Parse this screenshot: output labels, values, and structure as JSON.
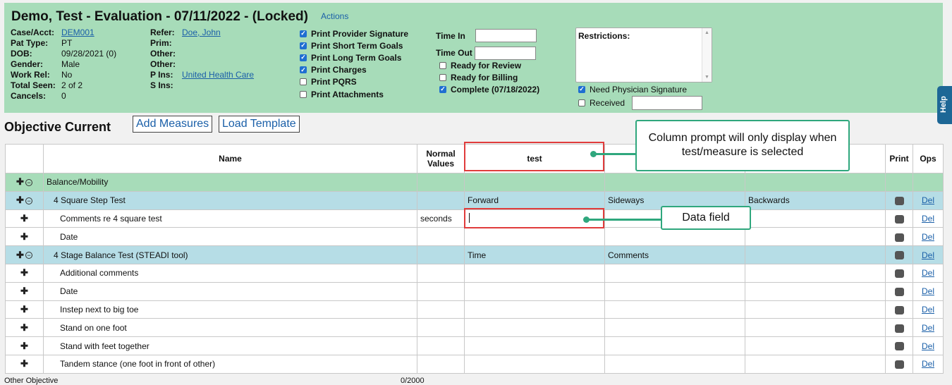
{
  "header": {
    "title": "Demo, Test - Evaluation - 07/11/2022 - (Locked)",
    "actions": "Actions",
    "left_info": [
      {
        "label": "Case/Acct:",
        "value": "DEM001",
        "link": true
      },
      {
        "label": "Pat Type:",
        "value": "PT"
      },
      {
        "label": "DOB:",
        "value": "09/28/2021 (0)"
      },
      {
        "label": "Gender:",
        "value": "Male"
      },
      {
        "label": "Work Rel:",
        "value": "No"
      },
      {
        "label": "Total Seen:",
        "value": "2 of 2"
      },
      {
        "label": "Cancels:",
        "value": "0"
      }
    ],
    "right_info": [
      {
        "label": "Refer:",
        "value": "Doe, John",
        "link": true
      },
      {
        "label": "Prim:",
        "value": ""
      },
      {
        "label": "Other:",
        "value": ""
      },
      {
        "label": "Other:",
        "value": ""
      },
      {
        "label": "P Ins:",
        "value": "United Health Care",
        "link": true
      },
      {
        "label": "S Ins:",
        "value": ""
      }
    ],
    "print_options": [
      {
        "label": "Print Provider Signature",
        "checked": true
      },
      {
        "label": "Print Short Term Goals",
        "checked": true
      },
      {
        "label": "Print Long Term Goals",
        "checked": true
      },
      {
        "label": "Print Charges",
        "checked": true
      },
      {
        "label": "Print PQRS",
        "checked": false
      },
      {
        "label": "Print Attachments",
        "checked": false
      }
    ],
    "time_in_label": "Time In",
    "time_out_label": "Time Out",
    "status_options": [
      {
        "label": "Ready for Review",
        "checked": false
      },
      {
        "label": "Ready for Billing",
        "checked": false
      },
      {
        "label": "Complete (07/18/2022)",
        "checked": true
      }
    ],
    "restrictions_label": "Restrictions:",
    "need_physician_signature": "Need Physician Signature",
    "received_label": "Received"
  },
  "help_label": "Help",
  "objective": {
    "title": "Objective Current",
    "add_measures": "Add Measures",
    "load_template": "Load Template"
  },
  "table": {
    "headers": {
      "name": "Name",
      "normal_values_1": "Normal",
      "normal_values_2": "Values",
      "col1": "test",
      "print": "Print",
      "ops": "Ops"
    },
    "rows": [
      {
        "name": "Balance/Mobility",
        "type": "group"
      },
      {
        "name": "4 Square Step Test",
        "type": "test",
        "c1": "Forward",
        "c2": "Sideways",
        "c3": "Backwards",
        "op": "Del"
      },
      {
        "name": "Comments re 4 square test",
        "type": "item",
        "normal": "seconds",
        "op": "Del"
      },
      {
        "name": "Date",
        "type": "item",
        "op": "Del"
      },
      {
        "name": "4 Stage Balance Test (STEADI tool)",
        "type": "test",
        "c1": "Time",
        "c2": "Comments",
        "op": "Del"
      },
      {
        "name": "Additional comments",
        "type": "item",
        "op": "Del"
      },
      {
        "name": "Date",
        "type": "item",
        "op": "Del"
      },
      {
        "name": "Instep next to big toe",
        "type": "item",
        "op": "Del"
      },
      {
        "name": "Stand on one foot",
        "type": "item",
        "op": "Del"
      },
      {
        "name": "Stand with feet together",
        "type": "item",
        "op": "Del"
      },
      {
        "name": "Tandem stance (one foot in front of other)",
        "type": "item",
        "op": "Del"
      }
    ]
  },
  "callouts": {
    "column_prompt": "Column prompt will only display when test/measure is selected",
    "data_field": "Data field"
  },
  "footer": {
    "left": "Other Objective",
    "right": "0/2000"
  }
}
